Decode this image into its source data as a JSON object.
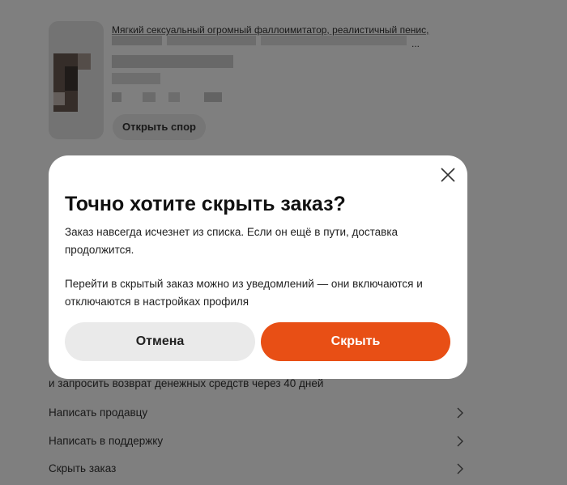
{
  "background": {
    "product": {
      "title": "Мягкий сексуальный огромный фаллоимитатор, реалистичный пенис,",
      "title_more": "...",
      "dispute_button": "Открыть спор"
    },
    "refund_note": "и запросить возврат денежных средств через 40 дней",
    "menu": [
      {
        "label": "Написать продавцу",
        "icon": "chevron-right-icon"
      },
      {
        "label": "Написать в поддержку",
        "icon": "chevron-right-icon"
      },
      {
        "label": "Скрыть заказ",
        "icon": "chevron-right-icon"
      }
    ]
  },
  "dialog": {
    "title": "Точно хотите скрыть заказ?",
    "text1": "Заказ навсегда исчезнет из списка. Если он ещё в пути, доставка продолжится.",
    "text2": "Перейти в скрытый заказ можно из уведомлений — они включаются и отключаются в настройках профиля",
    "cancel_label": "Отмена",
    "confirm_label": "Скрыть",
    "close_icon": "close-icon"
  },
  "colors": {
    "accent": "#e84f15",
    "overlay": "rgba(0,0,0,0.5)",
    "cancel_bg": "#eaeaea"
  }
}
